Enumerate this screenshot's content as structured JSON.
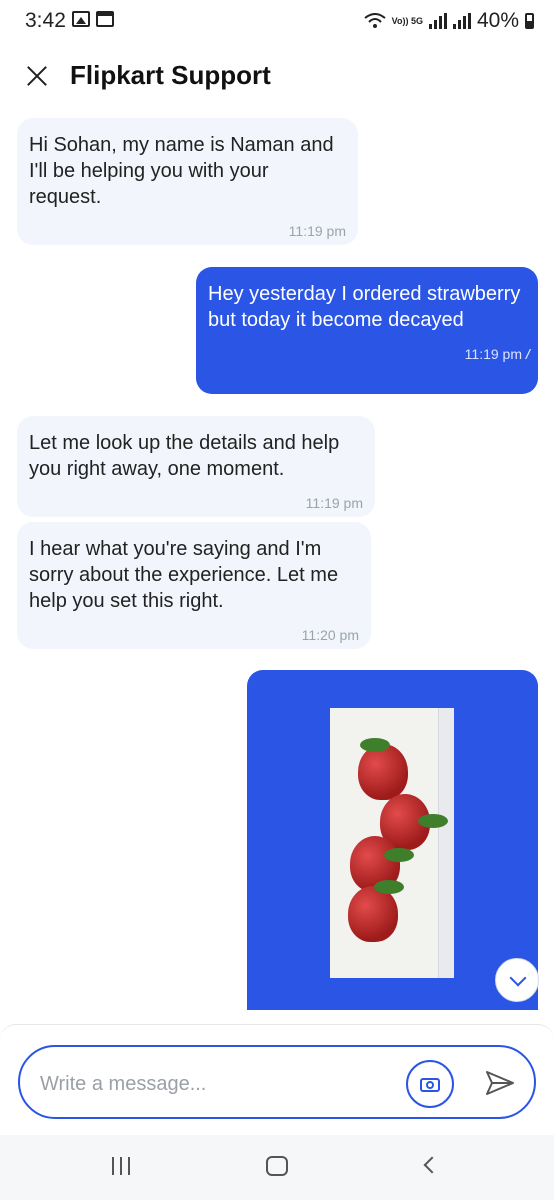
{
  "status_bar": {
    "time": "3:42",
    "network_label": "Vo)) 5G",
    "battery": "40%"
  },
  "header": {
    "title": "Flipkart Support",
    "close_icon": "close-icon"
  },
  "messages": [
    {
      "direction": "in",
      "text": "Hi Sohan, my name is Naman and I'll be helping you with your request.",
      "time": "11:19 pm"
    },
    {
      "direction": "out",
      "text": "Hey yesterday I ordered strawberry but today it become decayed",
      "time": "11:19 pm",
      "status_icon": "double-check-icon"
    },
    {
      "direction": "in",
      "text": "Let me look up the details and help you right away, one moment.",
      "time": "11:19 pm"
    },
    {
      "direction": "in",
      "text": "I hear what you're saying and I'm sorry about the experience. Let me help you set this right.",
      "time": "11:20 pm"
    }
  ],
  "image_message": {
    "direction": "out",
    "alt": "photo of strawberries"
  },
  "composer": {
    "placeholder": "Write a message...",
    "camera_icon": "camera-icon",
    "send_icon": "send-icon"
  },
  "colors": {
    "accent": "#2a55e5",
    "incoming_bubble": "#f2f6fc",
    "outgoing_bubble": "#2a55e5"
  }
}
